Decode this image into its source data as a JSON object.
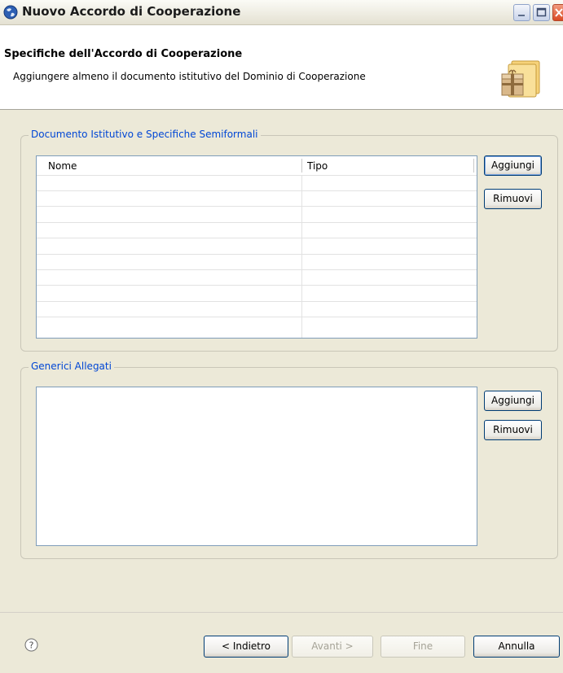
{
  "window": {
    "title": "Nuovo Accordo di Cooperazione"
  },
  "banner": {
    "title": "Specifiche dell'Accordo di Cooperazione",
    "description": "Aggiungere almeno il documento istitutivo del Dominio di Cooperazione",
    "image_icon": "package-wizard-icon"
  },
  "groups": {
    "documents": {
      "legend": "Documento Istitutivo e Specifiche Semiformali",
      "columns": [
        "Nome",
        "Tipo"
      ],
      "rows": [],
      "add_label": "Aggiungi",
      "remove_label": "Rimuovi"
    },
    "attachments": {
      "legend": "Generici Allegati",
      "items": [],
      "add_label": "Aggiungi",
      "remove_label": "Rimuovi"
    }
  },
  "footer": {
    "help_icon": "help-icon",
    "back_label": "< Indietro",
    "next_label": "Avanti >",
    "finish_label": "Fine",
    "cancel_label": "Annulla"
  },
  "colors": {
    "legend": "#0046d5",
    "dialog_bg": "#ece9d8",
    "list_border": "#7f9db9"
  }
}
